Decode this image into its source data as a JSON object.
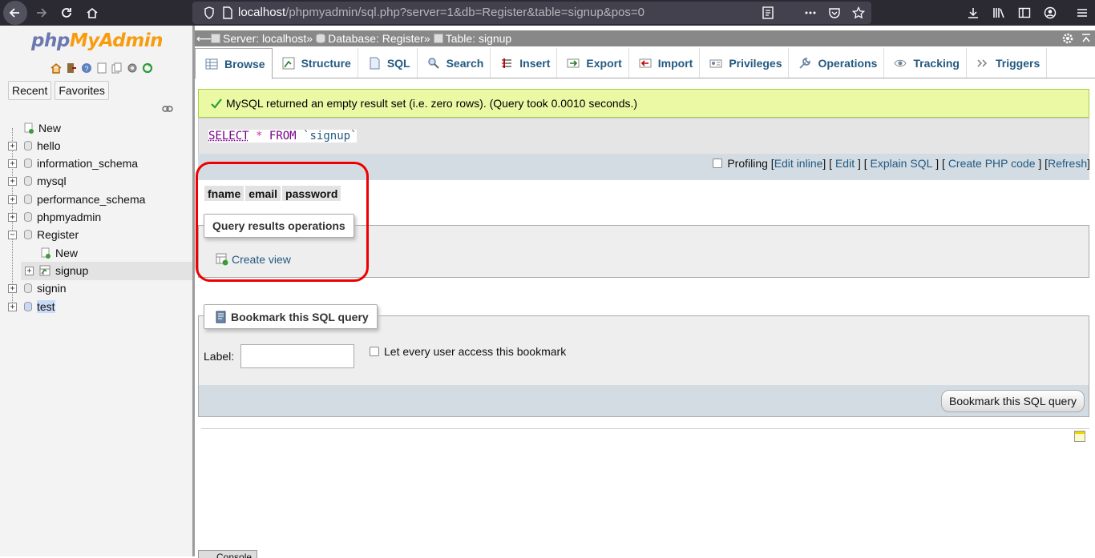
{
  "browser": {
    "url_host": "localhost",
    "url_path": "/phpmyadmin/sql.php?server=1&db=Register&table=signup&pos=0"
  },
  "logo": {
    "part1": "php",
    "part2": "MyAdmin"
  },
  "nav": {
    "recent_label": "Recent",
    "favorites_label": "Favorites",
    "tree": [
      {
        "label": "New"
      },
      {
        "label": "hello"
      },
      {
        "label": "information_schema"
      },
      {
        "label": "mysql"
      },
      {
        "label": "performance_schema"
      },
      {
        "label": "phpmyadmin"
      },
      {
        "label": "Register"
      },
      {
        "label": "New"
      },
      {
        "label": "signup"
      },
      {
        "label": "signin"
      },
      {
        "label": "test"
      }
    ]
  },
  "breadcrumb": {
    "server": "Server: localhost",
    "database": "Database: Register",
    "table": "Table: signup",
    "sep": "»"
  },
  "tabs": [
    {
      "label": "Browse"
    },
    {
      "label": "Structure"
    },
    {
      "label": "SQL"
    },
    {
      "label": "Search"
    },
    {
      "label": "Insert"
    },
    {
      "label": "Export"
    },
    {
      "label": "Import"
    },
    {
      "label": "Privileges"
    },
    {
      "label": "Operations"
    },
    {
      "label": "Tracking"
    },
    {
      "label": "Triggers"
    }
  ],
  "message": "MySQL returned an empty result set (i.e. zero rows). (Query took 0.0010 seconds.)",
  "sql": {
    "select": "SELECT",
    "star": "*",
    "from": "FROM",
    "table": "`signup`"
  },
  "sql_links": {
    "profiling": "Profiling",
    "edit_inline": "Edit inline",
    "edit": "Edit",
    "explain": "Explain SQL",
    "php": "Create PHP code",
    "refresh": "Refresh"
  },
  "columns": [
    "fname",
    "email",
    "password"
  ],
  "query_ops": {
    "legend": "Query results operations",
    "create_view": "Create view"
  },
  "bookmark": {
    "legend": "Bookmark this SQL query",
    "label": "Label:",
    "input_value": "",
    "share_label": "Let every user access this bookmark",
    "button": "Bookmark this SQL query"
  },
  "console": {
    "label": "Console"
  }
}
